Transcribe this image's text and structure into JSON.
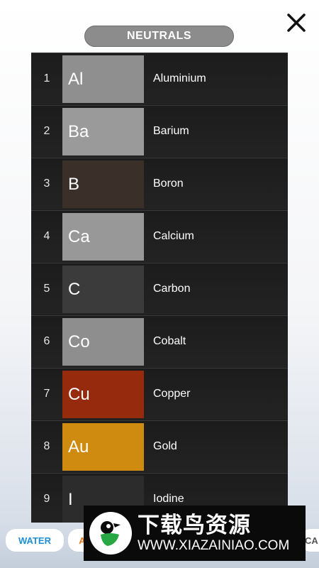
{
  "header": {
    "title": "NEUTRALS"
  },
  "elements": [
    {
      "num": "1",
      "symbol": "Al",
      "name": "Aluminium",
      "color": "#8f8f8f"
    },
    {
      "num": "2",
      "symbol": "Ba",
      "name": "Barium",
      "color": "#9a9a9a"
    },
    {
      "num": "3",
      "symbol": "B",
      "name": "Boron",
      "color": "#3b2f2a"
    },
    {
      "num": "4",
      "symbol": "Ca",
      "name": "Calcium",
      "color": "#989898"
    },
    {
      "num": "5",
      "symbol": "C",
      "name": "Carbon",
      "color": "#3b3b3b"
    },
    {
      "num": "6",
      "symbol": "Co",
      "name": "Cobalt",
      "color": "#8e8e8e"
    },
    {
      "num": "7",
      "symbol": "Cu",
      "name": "Copper",
      "color": "#962a0c"
    },
    {
      "num": "8",
      "symbol": "Au",
      "name": "Gold",
      "color": "#cf8a10"
    },
    {
      "num": "9",
      "symbol": "I",
      "name": "Iodine",
      "color": "#2c2c2c"
    }
  ],
  "tabs": {
    "water": "WATER",
    "partial_left": "A",
    "partial_right": "CA"
  },
  "watermark": {
    "main": "下载鸟资源",
    "url": "WWW.XIAZAINIAO.COM"
  },
  "colors": {
    "water_tab": "#1e8fd6",
    "orange_tab": "#e07a1f"
  }
}
